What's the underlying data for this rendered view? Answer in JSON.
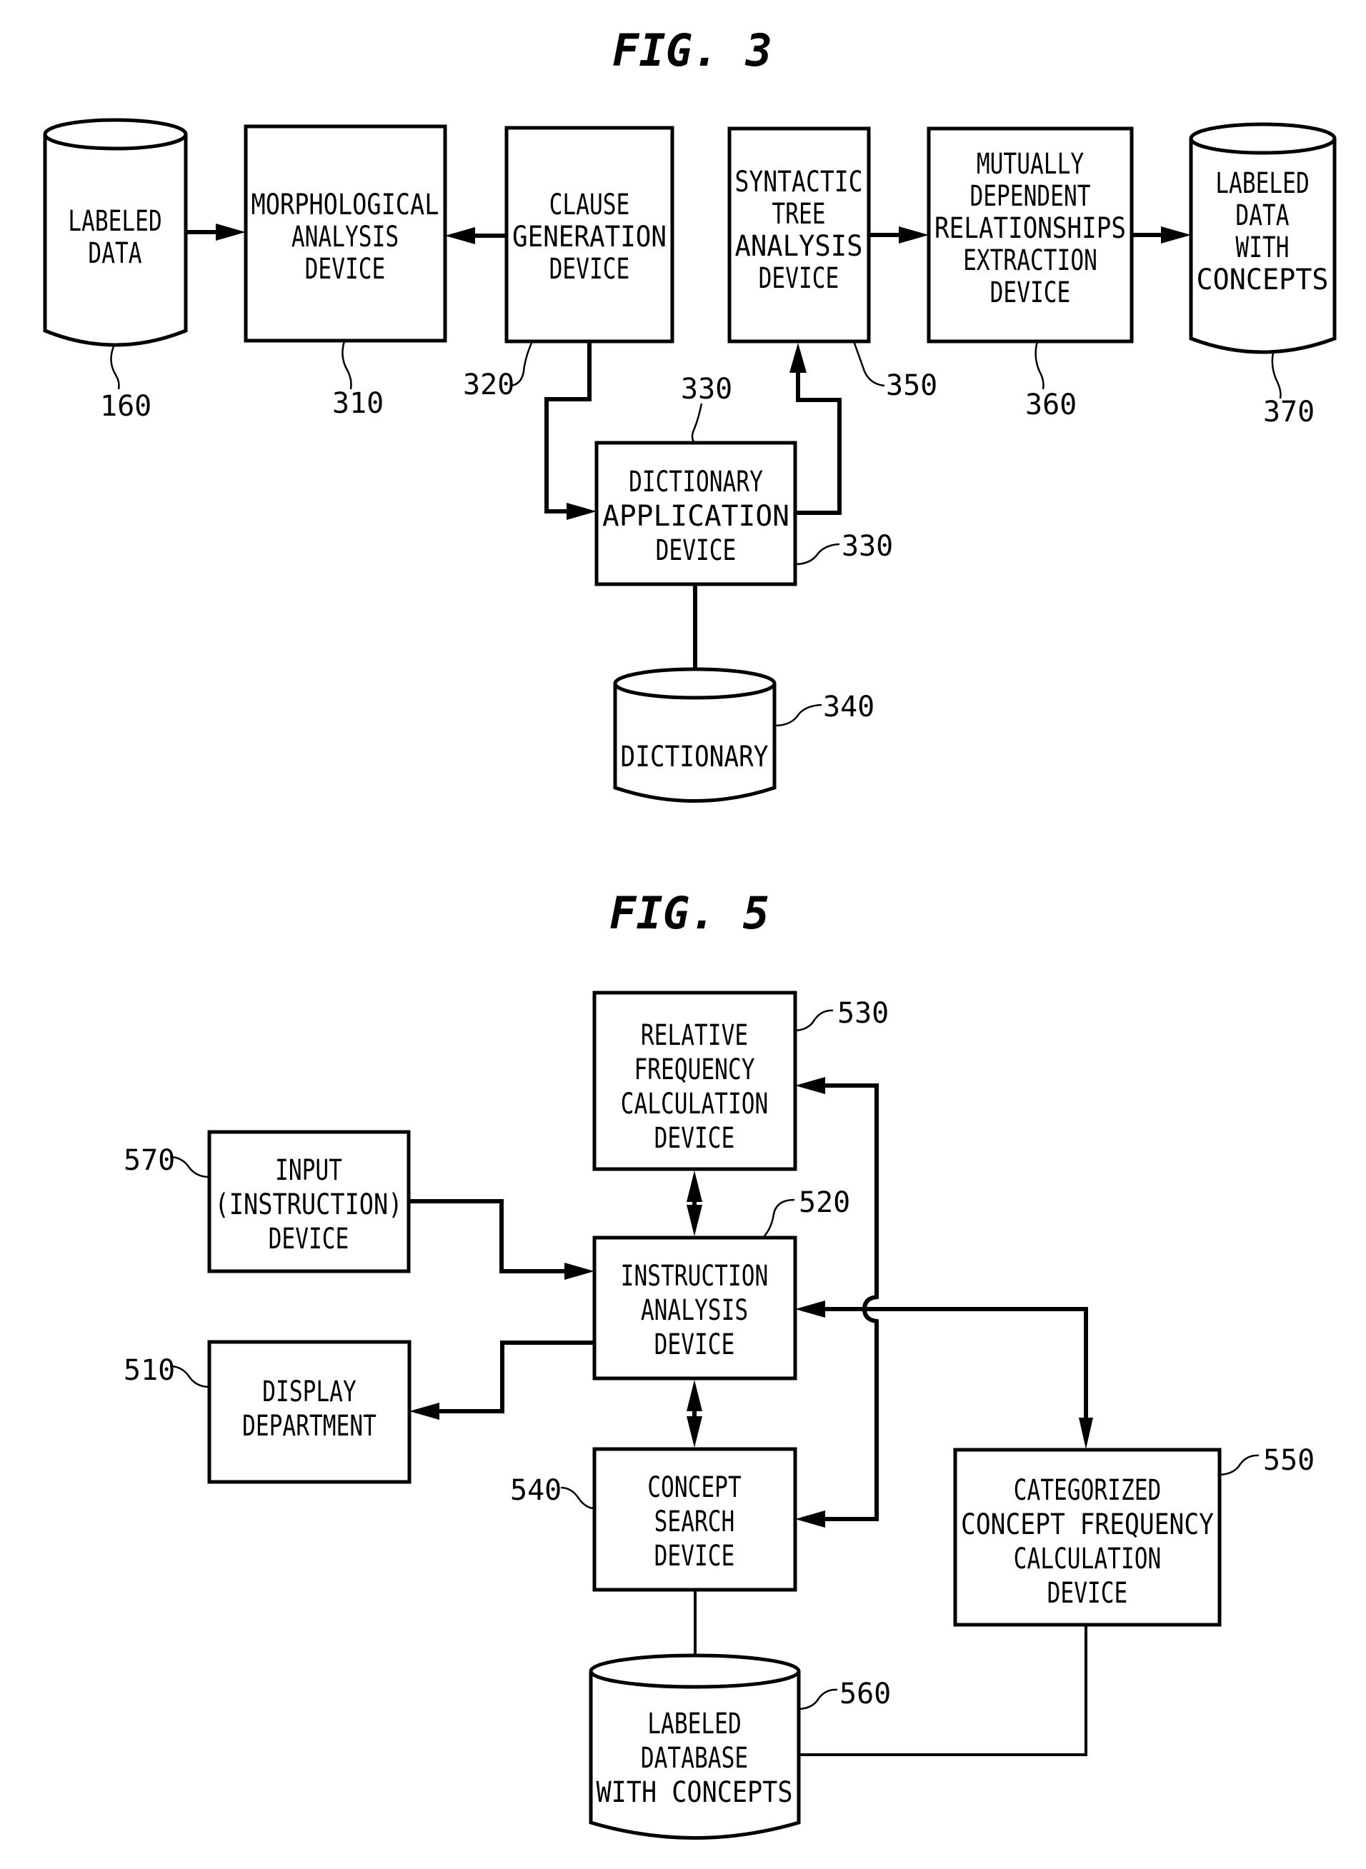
{
  "fig3": {
    "title": "FIG. 3",
    "nodes": {
      "labeled_data": {
        "ref": "160",
        "lines": [
          "LABELED",
          "DATA"
        ],
        "shape": "cylinder"
      },
      "morphological": {
        "ref": "310",
        "lines": [
          "MORPHOLOGICAL",
          "ANALYSIS",
          "DEVICE"
        ],
        "shape": "box"
      },
      "clause": {
        "ref": "320",
        "lines": [
          "CLAUSE",
          "GENERATION",
          "DEVICE"
        ],
        "shape": "box"
      },
      "dict_app": {
        "ref": "330",
        "ref2": "330",
        "lines": [
          "DICTIONARY",
          "APPLICATION",
          "DEVICE"
        ],
        "shape": "box"
      },
      "dictionary": {
        "ref": "340",
        "lines": [
          "DICTIONARY"
        ],
        "shape": "cylinder"
      },
      "syntactic": {
        "ref": "350",
        "lines": [
          "SYNTACTIC",
          "TREE",
          "ANALYSIS",
          "DEVICE"
        ],
        "shape": "box"
      },
      "mutual": {
        "ref": "360",
        "lines": [
          "MUTUALLY",
          "DEPENDENT",
          "RELATIONSHIPS",
          "EXTRACTION",
          "DEVICE"
        ],
        "shape": "box"
      },
      "labeled_concepts": {
        "ref": "370",
        "lines": [
          "LABELED",
          "DATA",
          "WITH",
          "CONCEPTS"
        ],
        "shape": "cylinder"
      }
    },
    "edges": [
      {
        "from": "labeled_data",
        "to": "morphological",
        "arrow": "end"
      },
      {
        "from": "clause",
        "to": "morphological",
        "arrow": "end"
      },
      {
        "from": "clause",
        "to": "dict_app",
        "arrow": "end"
      },
      {
        "from": "dict_app",
        "to": "syntactic",
        "arrow": "end"
      },
      {
        "from": "dict_app",
        "to": "dictionary",
        "arrow": "none"
      },
      {
        "from": "syntactic",
        "to": "mutual",
        "arrow": "end"
      },
      {
        "from": "mutual",
        "to": "labeled_concepts",
        "arrow": "end"
      }
    ]
  },
  "fig5": {
    "title": "FIG. 5",
    "nodes": {
      "relative": {
        "ref": "530",
        "lines": [
          "RELATIVE",
          "FREQUENCY",
          "CALCULATION",
          "DEVICE"
        ],
        "shape": "box"
      },
      "input": {
        "ref": "570",
        "lines": [
          "INPUT",
          "(INSTRUCTION)",
          "DEVICE"
        ],
        "shape": "box"
      },
      "instruction": {
        "ref": "520",
        "lines": [
          "INSTRUCTION",
          "ANALYSIS",
          "DEVICE"
        ],
        "shape": "box"
      },
      "display": {
        "ref": "510",
        "lines": [
          "DISPLAY",
          "DEPARTMENT"
        ],
        "shape": "box"
      },
      "concept_search": {
        "ref": "540",
        "lines": [
          "CONCEPT",
          "SEARCH",
          "DEVICE"
        ],
        "shape": "box"
      },
      "categorized": {
        "ref": "550",
        "lines": [
          "CATEGORIZED",
          "CONCEPT FREQUENCY",
          "CALCULATION",
          "DEVICE"
        ],
        "shape": "box"
      },
      "labeled_db": {
        "ref": "560",
        "lines": [
          "LABELED",
          "DATABASE",
          "WITH CONCEPTS"
        ],
        "shape": "cylinder"
      }
    },
    "edges": [
      {
        "from": "relative",
        "to": "instruction",
        "arrow": "both"
      },
      {
        "from": "input",
        "to": "instruction",
        "arrow": "end"
      },
      {
        "from": "instruction",
        "to": "display",
        "arrow": "end"
      },
      {
        "from": "instruction",
        "to": "concept_search",
        "arrow": "both"
      },
      {
        "from": "labeled_db",
        "to": "relative",
        "arrow": "end"
      },
      {
        "from": "labeled_db",
        "to": "concept_search",
        "arrow": "end"
      },
      {
        "from": "labeled_db",
        "to": "instruction",
        "arrow": "end"
      },
      {
        "from": "labeled_db",
        "to": "categorized",
        "arrow": "end"
      },
      {
        "from": "concept_search",
        "to": "labeled_db",
        "arrow": "none"
      }
    ]
  }
}
